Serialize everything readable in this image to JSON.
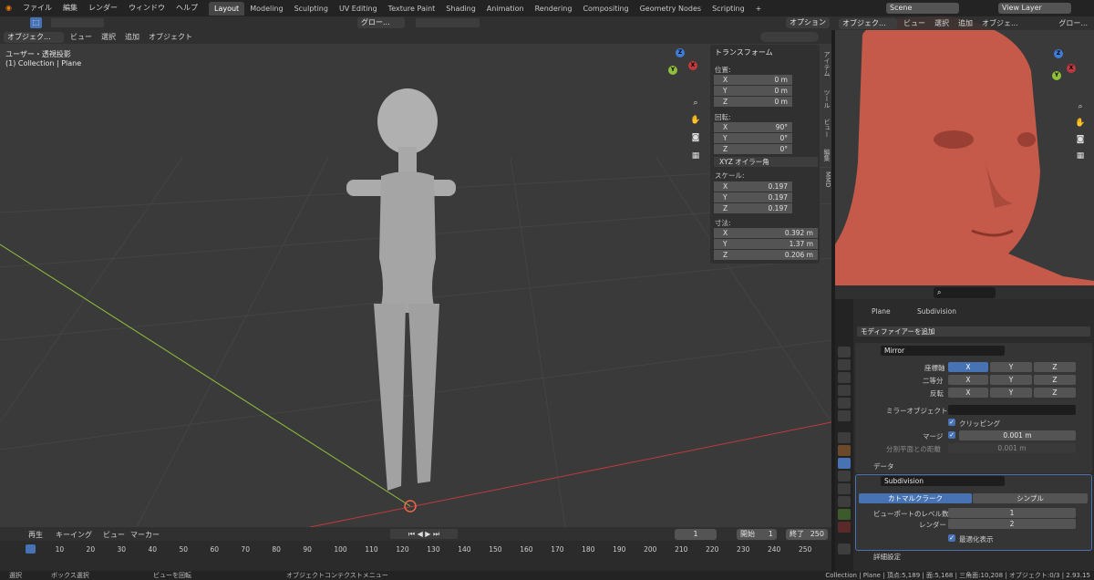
{
  "topbar": {
    "menus": [
      "ファイル",
      "編集",
      "レンダー",
      "ウィンドウ",
      "ヘルプ"
    ],
    "workspaces": [
      "Layout",
      "Modeling",
      "Sculpting",
      "UV Editing",
      "Texture Paint",
      "Shading",
      "Animation",
      "Rendering",
      "Compositing",
      "Geometry Nodes",
      "Scripting"
    ],
    "active_workspace": "Layout",
    "scene": "Scene",
    "view_layer": "View Layer"
  },
  "viewport": {
    "mode": "オブジェク...",
    "menus": [
      "ビュー",
      "選択",
      "追加",
      "オブジェクト"
    ],
    "transform_orientation": "グロー...",
    "options": "オプション",
    "overlay_title": "ユーザー・透視投影",
    "overlay_sub": "(1) Collection | Plane"
  },
  "npanel": {
    "title": "トランスフォーム",
    "location_label": "位置:",
    "location": [
      {
        "k": "X",
        "v": "0 m"
      },
      {
        "k": "Y",
        "v": "0 m"
      },
      {
        "k": "Z",
        "v": "0 m"
      }
    ],
    "rotation_label": "回転:",
    "rotation": [
      {
        "k": "X",
        "v": "90°"
      },
      {
        "k": "Y",
        "v": "0°"
      },
      {
        "k": "Z",
        "v": "0°"
      }
    ],
    "rotation_mode": "XYZ オイラー角",
    "scale_label": "スケール:",
    "scale": [
      {
        "k": "X",
        "v": "0.197"
      },
      {
        "k": "Y",
        "v": "0.197"
      },
      {
        "k": "Z",
        "v": "0.197"
      }
    ],
    "dims_label": "寸法:",
    "dims": [
      {
        "k": "X",
        "v": "0.392 m"
      },
      {
        "k": "Y",
        "v": "1.37 m"
      },
      {
        "k": "Z",
        "v": "0.206 m"
      }
    ],
    "tabs": [
      "アイテム",
      "ツール",
      "ビュー",
      "編集",
      "MMD"
    ]
  },
  "right_viewport": {
    "mode": "オブジェク...",
    "menus": [
      "ビュー",
      "選択",
      "追加",
      "オブジェ..."
    ],
    "orientation": "グロー..."
  },
  "properties": {
    "object": "Plane",
    "modifier_ctx": "Subdivision",
    "add_modifier": "モディファイアーを追加",
    "mirror": {
      "name": "Mirror",
      "axis_label": "座標軸",
      "bisect_label": "二等分",
      "flip_label": "反転",
      "axes": [
        "X",
        "Y",
        "Z"
      ],
      "mirror_object_label": "ミラーオブジェクト",
      "clipping": "クリッピング",
      "merge_label": "マージ",
      "merge_value": "0.001 m",
      "bisect_dist_label": "分割平面との距離",
      "bisect_dist_value": "0.001 m",
      "data_panel": "データ"
    },
    "subdivision": {
      "name": "Subdivision",
      "catmull": "カトマルクラーク",
      "simple": "シンプル",
      "viewport_levels_label": "ビューポートのレベル数",
      "viewport_levels": "1",
      "render_label": "レンダー",
      "render_levels": "2",
      "optimal": "最適化表示",
      "advanced": "詳細設定"
    }
  },
  "timeline": {
    "menus": [
      "再生",
      "キーイング",
      "ビュー",
      "マーカー"
    ],
    "current_frame": "1",
    "start_label": "開始",
    "start": "1",
    "end_label": "終了",
    "end": "250",
    "ticks": [
      "1",
      "10",
      "20",
      "30",
      "40",
      "50",
      "60",
      "70",
      "80",
      "90",
      "100",
      "110",
      "120",
      "130",
      "140",
      "150",
      "160",
      "170",
      "180",
      "190",
      "200",
      "210",
      "220",
      "230",
      "240",
      "250"
    ]
  },
  "status": {
    "select": "選択",
    "box_select": "ボックス選択",
    "rotate_view": "ビューを回転",
    "context_menu": "オブジェクトコンテクストメニュー",
    "stats": "Collection | Plane | 頂点:5,189 | 面:5,168 | 三角面:10,208 | オブジェクト:0/3 | 2.93.15"
  },
  "colors": {
    "accent": "#4772b3",
    "axis_red": "#c0393f",
    "axis_green": "#8fbf3c",
    "skin": "#c55a4a"
  }
}
